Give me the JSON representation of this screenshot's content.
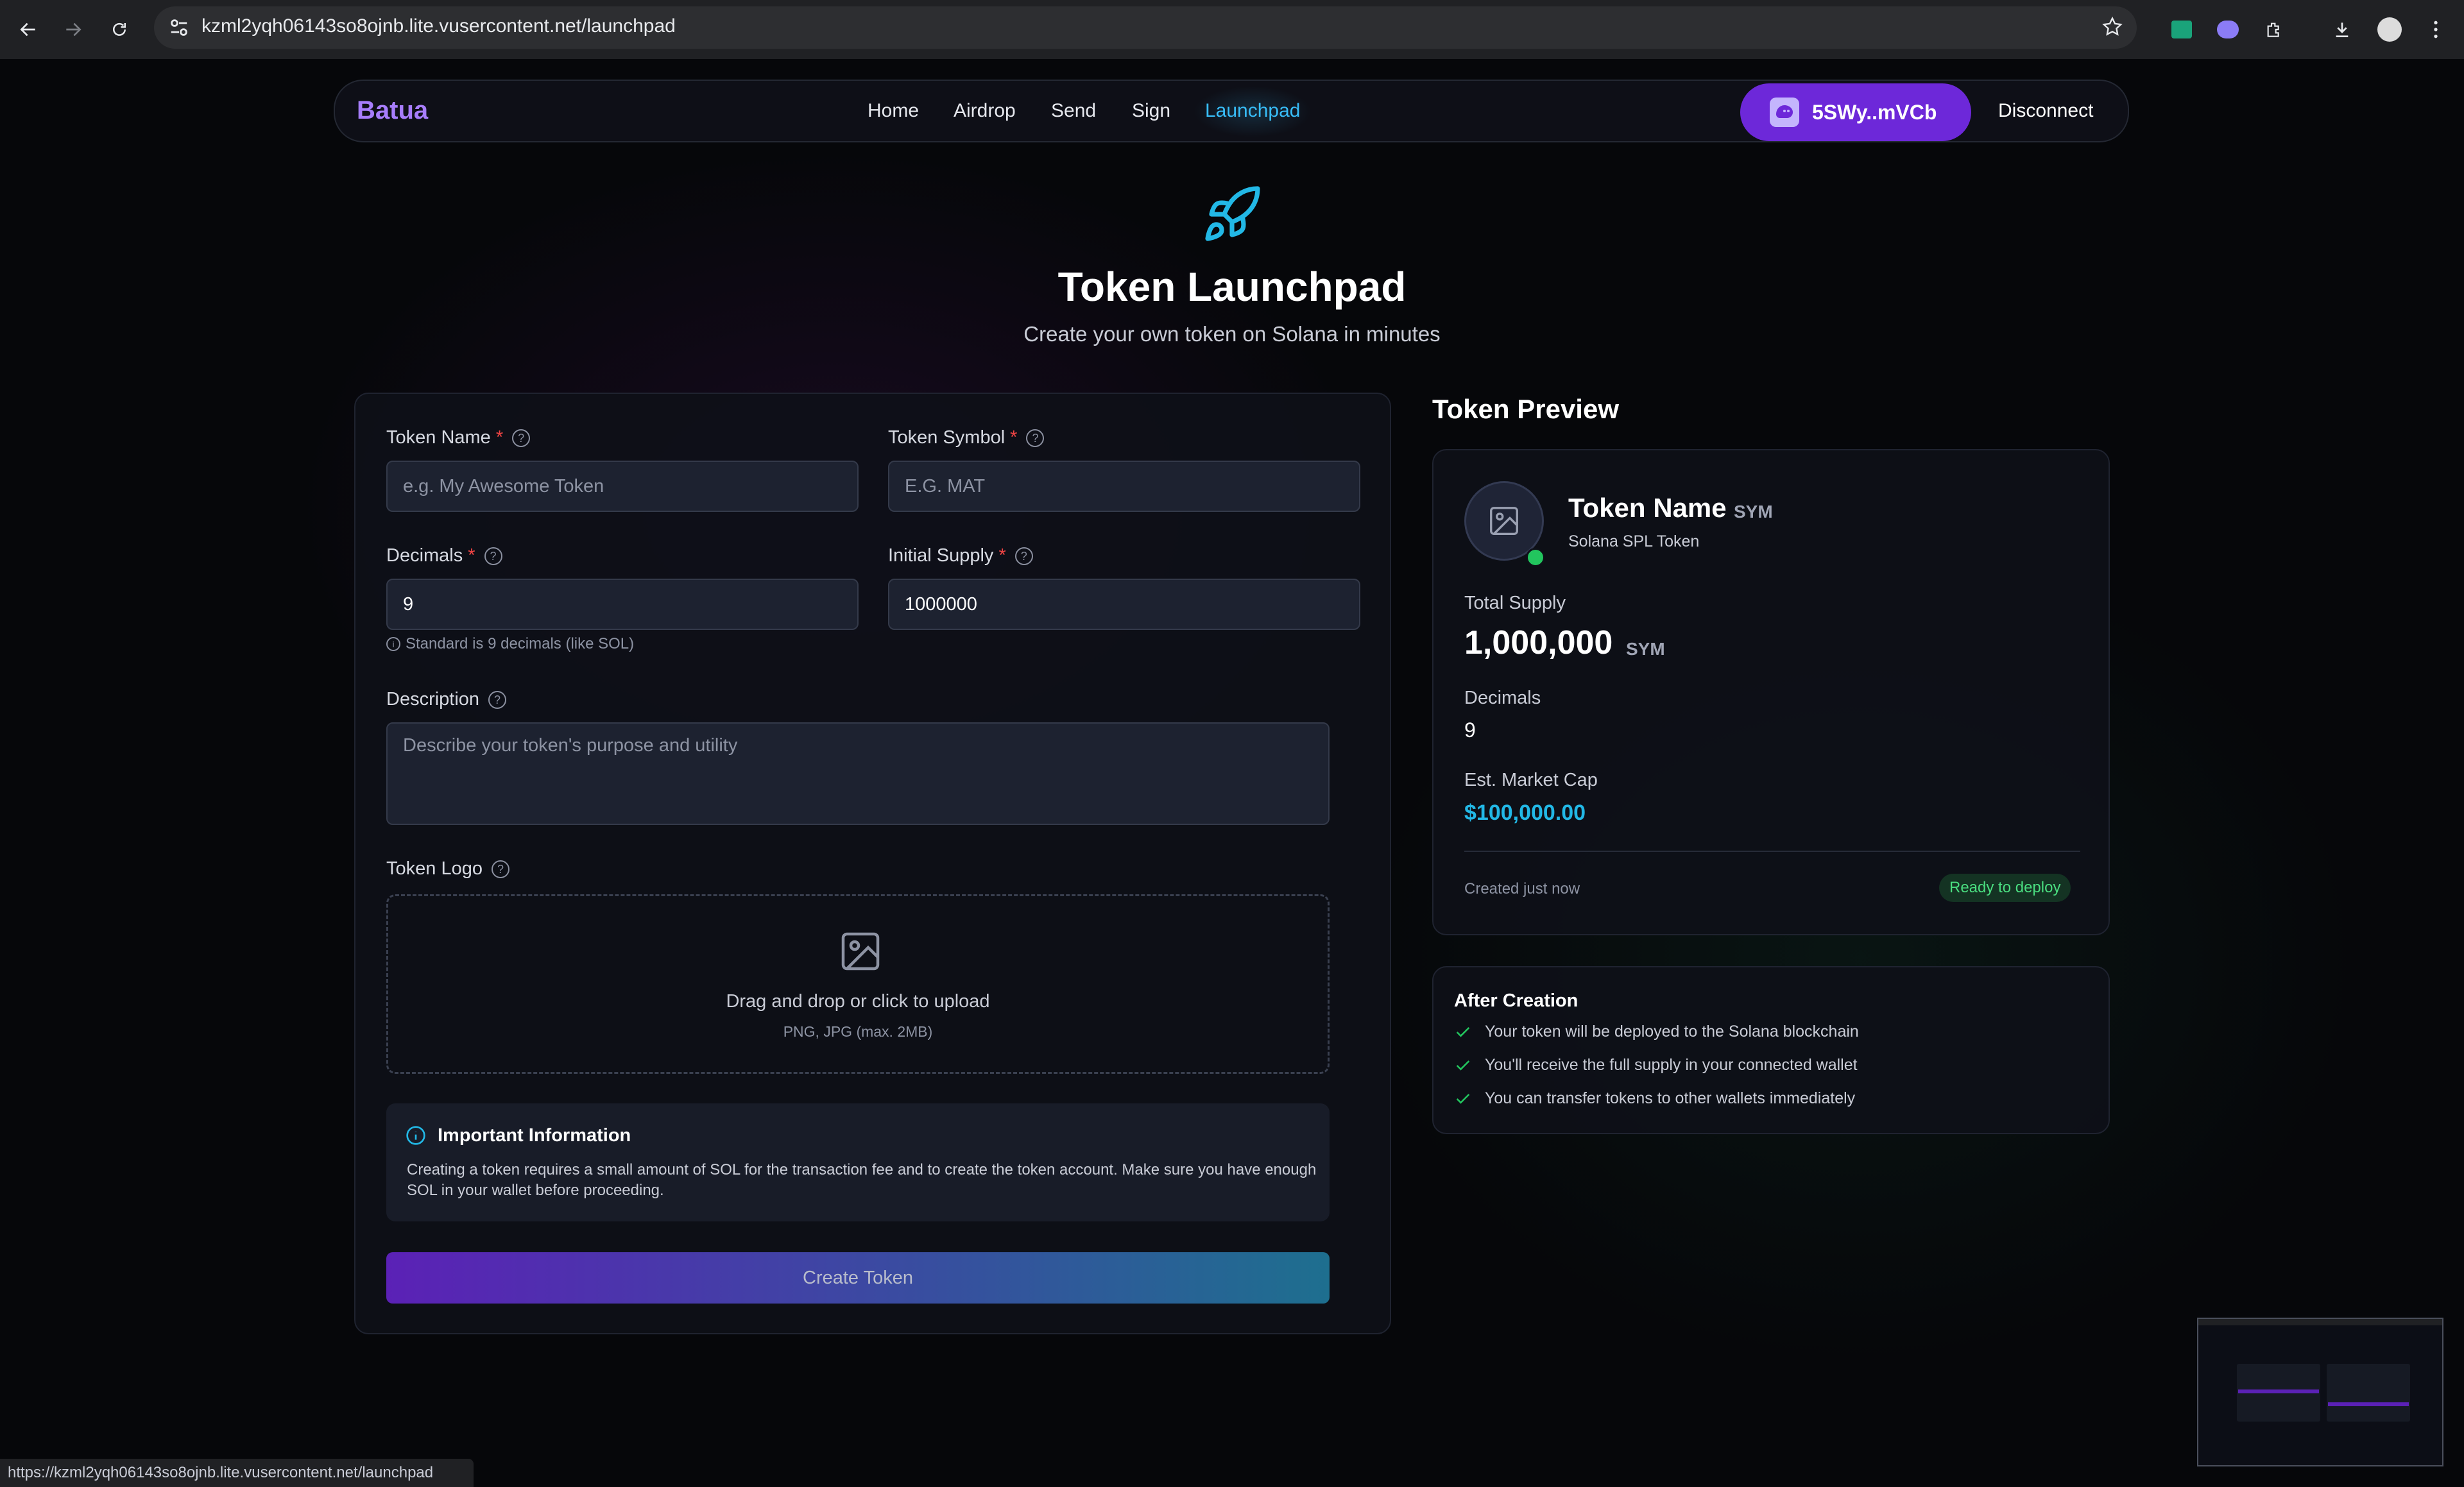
{
  "browser": {
    "url": "kzml2yqh06143so8ojnb.lite.vusercontent.net/launchpad",
    "status_url": "https://kzml2yqh06143so8ojnb.lite.vusercontent.net/launchpad"
  },
  "nav": {
    "brand": "Batua",
    "links": [
      "Home",
      "Airdrop",
      "Send",
      "Sign",
      "Launchpad"
    ],
    "active": "Launchpad",
    "wallet": "5SWy..mVCb",
    "disconnect": "Disconnect"
  },
  "hero": {
    "title": "Token Launchpad",
    "subtitle": "Create your own token on Solana in minutes"
  },
  "form": {
    "token_name": {
      "label": "Token Name",
      "required": "*",
      "placeholder": "e.g. My Awesome Token"
    },
    "token_symbol": {
      "label": "Token Symbol",
      "required": "*",
      "placeholder": "E.G. MAT"
    },
    "decimals": {
      "label": "Decimals",
      "required": "*",
      "value": "9",
      "hint": "Standard is 9 decimals (like SOL)"
    },
    "initial_supply": {
      "label": "Initial Supply",
      "required": "*",
      "value": "1000000"
    },
    "description": {
      "label": "Description",
      "placeholder": "Describe your token's purpose and utility"
    },
    "logo": {
      "label": "Token Logo",
      "upload_text": "Drag and drop or click to upload",
      "upload_sub": "PNG, JPG (max. 2MB)"
    },
    "info": {
      "title": "Important Information",
      "text": "Creating a token requires a small amount of SOL for the transaction fee and to create the token account. Make sure you have enough SOL in your wallet before proceeding."
    },
    "submit": "Create Token"
  },
  "preview": {
    "heading": "Token Preview",
    "name": "Token Name",
    "symbol": "SYM",
    "type": "Solana SPL Token",
    "supply_label": "Total Supply",
    "supply": "1,000,000",
    "decimals_label": "Decimals",
    "decimals": "9",
    "mcap_label": "Est. Market Cap",
    "mcap": "$100,000.00",
    "created": "Created just now",
    "status": "Ready to deploy"
  },
  "after": {
    "title": "After Creation",
    "items": [
      "Your token will be deployed to the Solana blockchain",
      "You'll receive the full supply in your connected wallet",
      "You can transfer tokens to other wallets immediately"
    ]
  },
  "colors": {
    "accent": "#6d28d9",
    "active_link": "#38bdf8",
    "success": "#22c55e",
    "mcap": "#22b8e6"
  }
}
